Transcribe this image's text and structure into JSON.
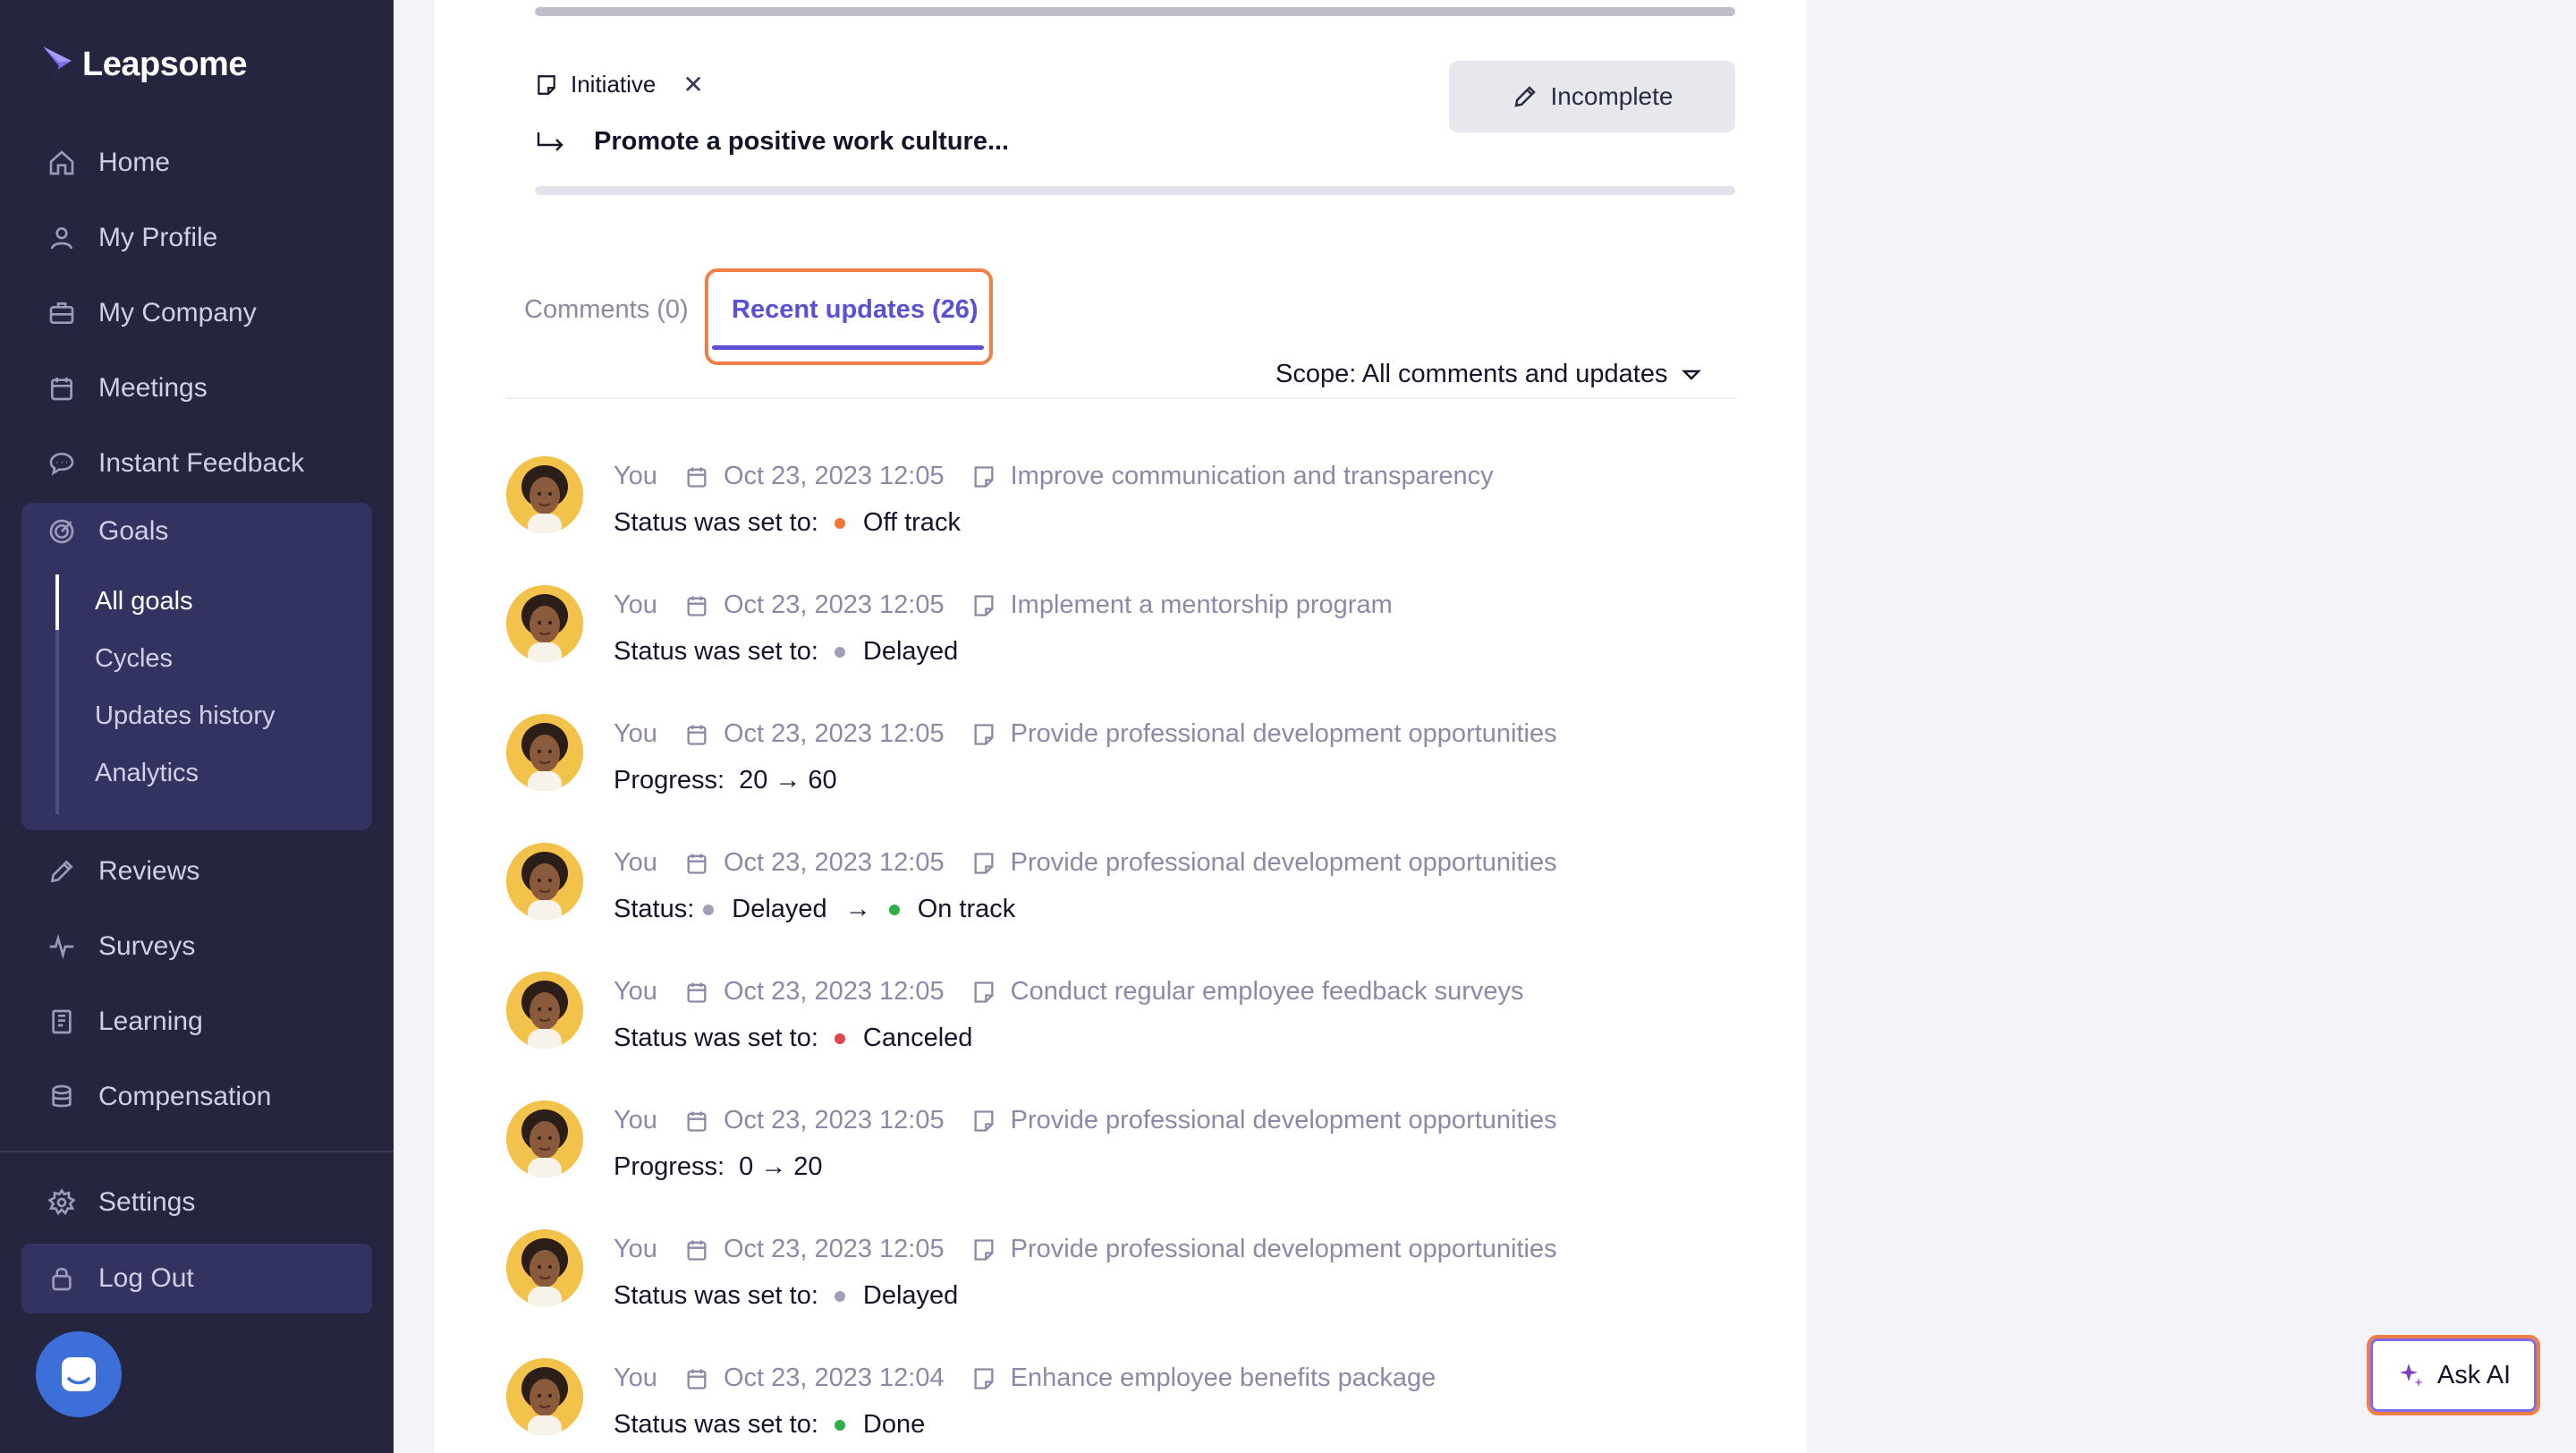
{
  "brand": {
    "name": "Leapsome"
  },
  "nav": {
    "home": "Home",
    "my_profile": "My Profile",
    "my_company": "My Company",
    "meetings": "Meetings",
    "instant_feedback": "Instant Feedback",
    "goals": "Goals",
    "goals_sub": [
      "All goals",
      "Cycles",
      "Updates history",
      "Analytics"
    ],
    "reviews": "Reviews",
    "surveys": "Surveys",
    "learning": "Learning",
    "compensation": "Compensation",
    "settings": "Settings",
    "logout": "Log Out"
  },
  "goal": {
    "type_label": "Initiative",
    "close_symbol": "✕",
    "parent_title": "Promote a positive work culture...",
    "status_button": "Incomplete"
  },
  "tabs": {
    "comments": "Comments (0)",
    "recent": "Recent updates (26)"
  },
  "scope": "Scope: All comments and updates",
  "updates": [
    {
      "who": "You",
      "date": "Oct 23, 2023 12:05",
      "goal": "Improve communication and transparency",
      "label": "Status was set to:",
      "from": "",
      "to": "Off track",
      "to_color": "#f0763a",
      "kind": "status"
    },
    {
      "who": "You",
      "date": "Oct 23, 2023 12:05",
      "goal": "Implement a mentorship program",
      "label": "Status was set to:",
      "from": "",
      "to": "Delayed",
      "to_color": "#a0a0b4",
      "kind": "status"
    },
    {
      "who": "You",
      "date": "Oct 23, 2023 12:05",
      "goal": "Provide professional development opportunities",
      "label": "Progress:",
      "from": "20",
      "to": "60",
      "kind": "progress"
    },
    {
      "who": "You",
      "date": "Oct 23, 2023 12:05",
      "goal": "Provide professional development opportunities",
      "label": "Status:",
      "from": "Delayed",
      "from_color": "#a0a0b4",
      "to": "On track",
      "to_color": "#2fae4a",
      "kind": "status-change"
    },
    {
      "who": "You",
      "date": "Oct 23, 2023 12:05",
      "goal": "Conduct regular employee feedback surveys",
      "label": "Status was set to:",
      "from": "",
      "to": "Canceled",
      "to_color": "#e0464e",
      "kind": "status"
    },
    {
      "who": "You",
      "date": "Oct 23, 2023 12:05",
      "goal": "Provide professional development opportunities",
      "label": "Progress:",
      "from": "0",
      "to": "20",
      "kind": "progress"
    },
    {
      "who": "You",
      "date": "Oct 23, 2023 12:05",
      "goal": "Provide professional development opportunities",
      "label": "Status was set to:",
      "from": "",
      "to": "Delayed",
      "to_color": "#a0a0b4",
      "kind": "status"
    },
    {
      "who": "You",
      "date": "Oct 23, 2023 12:04",
      "goal": "Enhance employee benefits package",
      "label": "Status was set to:",
      "from": "",
      "to": "Done",
      "to_color": "#2fae4a",
      "kind": "status"
    }
  ],
  "arrow_symbol": "→",
  "ask_ai": "Ask AI",
  "icons": {
    "home": "home-icon",
    "profile": "user-icon",
    "company": "briefcase-icon",
    "meetings": "calendar-icon",
    "feedback": "chat-icon",
    "goals": "target-icon",
    "reviews": "pencil-icon",
    "surveys": "pulse-icon",
    "learning": "book-icon",
    "compensation": "coins-icon",
    "settings": "gear-icon",
    "logout": "lock-icon"
  },
  "colors": {
    "sidebar": "#25253f",
    "accent": "#5a4fd6",
    "highlight": "#ef7f45"
  }
}
